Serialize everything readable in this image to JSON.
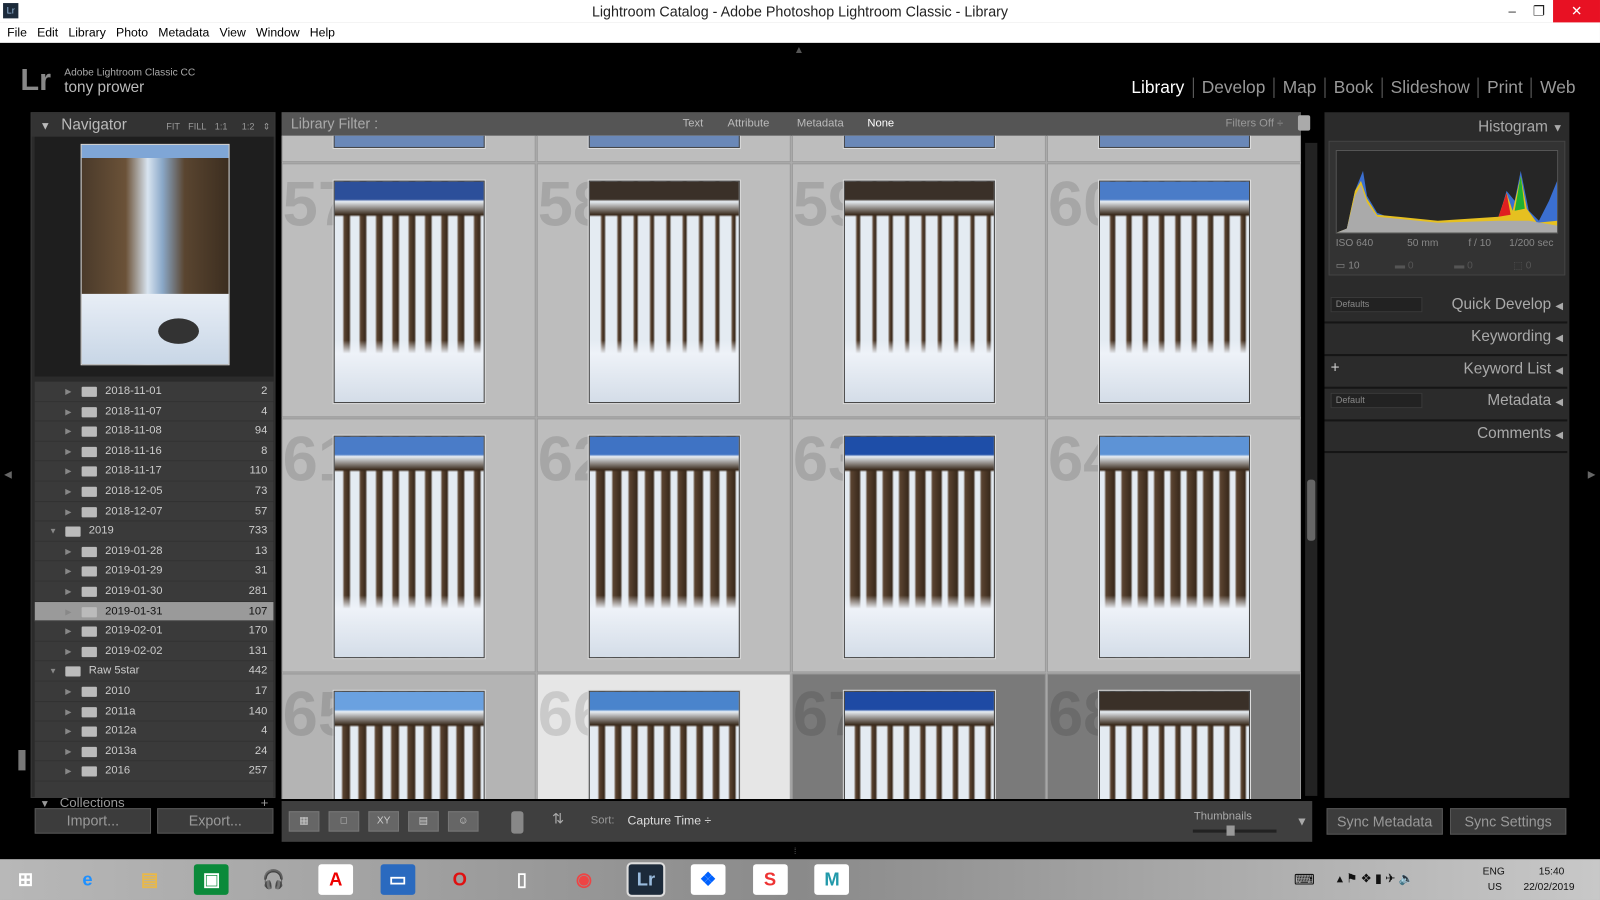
{
  "window": {
    "title": "Lightroom Catalog - Adobe Photoshop Lightroom Classic - Library",
    "app_icon": "Lr"
  },
  "menu": [
    "File",
    "Edit",
    "Library",
    "Photo",
    "Metadata",
    "View",
    "Window",
    "Help"
  ],
  "identity": {
    "logo": "Lr",
    "product": "Adobe Lightroom Classic CC",
    "user": "tony prower"
  },
  "modules": [
    {
      "label": "Library",
      "active": true
    },
    {
      "label": "Develop"
    },
    {
      "label": "Map"
    },
    {
      "label": "Book"
    },
    {
      "label": "Slideshow"
    },
    {
      "label": "Print"
    },
    {
      "label": "Web"
    }
  ],
  "navigator": {
    "title": "Navigator",
    "zoom_options": [
      "FIT",
      "FILL",
      "1:1",
      "1:2"
    ]
  },
  "folders": [
    {
      "name": "2018-11-01",
      "count": "2",
      "level": 2
    },
    {
      "name": "2018-11-07",
      "count": "4",
      "level": 2
    },
    {
      "name": "2018-11-08",
      "count": "94",
      "level": 2
    },
    {
      "name": "2018-11-16",
      "count": "8",
      "level": 2
    },
    {
      "name": "2018-11-17",
      "count": "110",
      "level": 2
    },
    {
      "name": "2018-12-05",
      "count": "73",
      "level": 2
    },
    {
      "name": "2018-12-07",
      "count": "57",
      "level": 2
    },
    {
      "name": "2019",
      "count": "733",
      "level": 1,
      "expanded": true
    },
    {
      "name": "2019-01-28",
      "count": "13",
      "level": 2
    },
    {
      "name": "2019-01-29",
      "count": "31",
      "level": 2
    },
    {
      "name": "2019-01-30",
      "count": "281",
      "level": 2
    },
    {
      "name": "2019-01-31",
      "count": "107",
      "level": 2,
      "selected": true
    },
    {
      "name": "2019-02-01",
      "count": "170",
      "level": 2
    },
    {
      "name": "2019-02-02",
      "count": "131",
      "level": 2
    },
    {
      "name": "Raw 5star",
      "count": "442",
      "level": 1,
      "expanded": true
    },
    {
      "name": "2010",
      "count": "17",
      "level": 2
    },
    {
      "name": "2011a",
      "count": "140",
      "level": 2
    },
    {
      "name": "2012a",
      "count": "4",
      "level": 2
    },
    {
      "name": "2013a",
      "count": "24",
      "level": 2
    },
    {
      "name": "2016",
      "count": "257",
      "level": 2
    }
  ],
  "collections": {
    "title": "Collections",
    "add": "+"
  },
  "left_buttons": {
    "import": "Import...",
    "export": "Export..."
  },
  "filter": {
    "label": "Library Filter :",
    "options": [
      "Text",
      "Attribute",
      "Metadata",
      "None"
    ],
    "active": "None",
    "filters_off": "Filters Off ÷"
  },
  "grid": {
    "cells": [
      {
        "num": "57",
        "sky": "#2c4f9a",
        "ice": 0.6
      },
      {
        "num": "58",
        "sky": "#3a3028",
        "ice": 0.8
      },
      {
        "num": "59",
        "sky": "#3a3028",
        "ice": 0.8
      },
      {
        "num": "60",
        "sky": "#4a7cc8",
        "ice": 0.7
      },
      {
        "num": "61",
        "sky": "#4a7cc8",
        "ice": 0.6
      },
      {
        "num": "62",
        "sky": "#3f73c4",
        "ice": 0.4
      },
      {
        "num": "63",
        "sky": "#1e4ea8",
        "ice": 0.3
      },
      {
        "num": "64",
        "sky": "#5d93d6",
        "ice": 0.3
      },
      {
        "num": "65",
        "sky": "#6aa1e0",
        "ice": 0.5
      },
      {
        "num": "66",
        "sky": "#4a84cc",
        "ice": 0.6,
        "selected": true
      },
      {
        "num": "67",
        "sky": "#1e4aa4",
        "ice": 0.7
      },
      {
        "num": "68",
        "sky": "#3a3028",
        "ice": 0.7
      }
    ]
  },
  "toolbar": {
    "sort_label": "Sort:",
    "sort_value": "Capture Time ÷",
    "thumbnails_label": "Thumbnails",
    "thumbnail_size": 0.45,
    "view_buttons": [
      "grid-view",
      "loupe-view",
      "compare-view",
      "survey-view",
      "people-view"
    ],
    "compare_label": "XY"
  },
  "right_panel": {
    "histogram": "Histogram",
    "exif": {
      "iso": "ISO 640",
      "focal": "50 mm",
      "aperture": "f / 10",
      "shutter": "1/200 sec"
    },
    "counts": [
      "10",
      "0",
      "0",
      "0"
    ],
    "sections": [
      "Quick Develop",
      "Keywording",
      "Keyword List",
      "Metadata",
      "Comments"
    ],
    "quick_develop_preset": "Defaults",
    "metadata_preset": "Default",
    "keyword_add": "+"
  },
  "sync": {
    "metadata": "Sync Metadata",
    "settings": "Sync Settings"
  },
  "taskbar": {
    "apps": [
      "windows-start",
      "internet-explorer",
      "file-explorer",
      "store",
      "headphones",
      "adobe",
      "lenovo",
      "opera",
      "file",
      "chrome",
      "lightroom",
      "dropbox",
      "s-app",
      "m-app"
    ],
    "lang": "ENG",
    "region": "US",
    "time": "15:40",
    "date": "22/02/2019"
  }
}
